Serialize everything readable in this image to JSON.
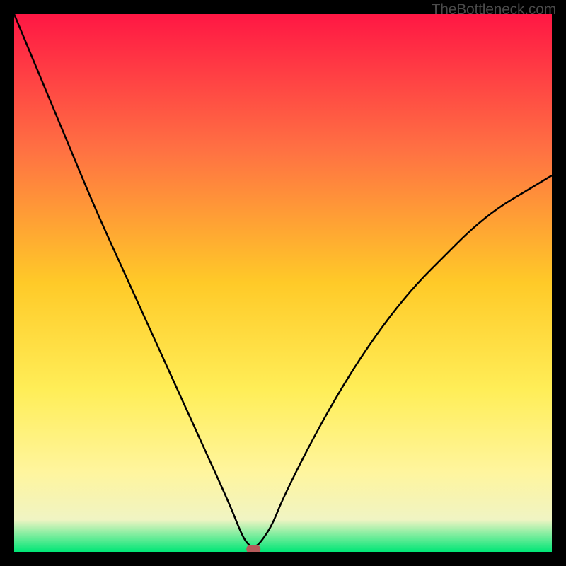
{
  "watermark": "TheBottleneck.com",
  "chart_data": {
    "type": "line",
    "title": "",
    "xlabel": "",
    "ylabel": "",
    "xlim": [
      0,
      100
    ],
    "ylim": [
      0,
      100
    ],
    "grid": false,
    "legend": false,
    "background_gradient": {
      "stops": [
        {
          "offset": 0,
          "color": "#ff1744"
        },
        {
          "offset": 25,
          "color": "#ff7043"
        },
        {
          "offset": 50,
          "color": "#ffca28"
        },
        {
          "offset": 70,
          "color": "#ffee58"
        },
        {
          "offset": 85,
          "color": "#fff59d"
        },
        {
          "offset": 94,
          "color": "#f0f4c3"
        },
        {
          "offset": 100,
          "color": "#00e676"
        }
      ]
    },
    "series": [
      {
        "name": "bottleneck-curve",
        "type": "line",
        "color": "#000000",
        "x": [
          0,
          5,
          10,
          15,
          20,
          25,
          30,
          35,
          40,
          42,
          43,
          44,
          45,
          46,
          48,
          50,
          55,
          60,
          65,
          70,
          75,
          80,
          85,
          90,
          95,
          100
        ],
        "y": [
          100,
          88,
          76,
          64,
          53,
          42,
          31,
          20,
          9,
          4,
          2,
          1,
          1,
          2,
          5,
          10,
          20,
          29,
          37,
          44,
          50,
          55,
          60,
          64,
          67,
          70
        ]
      }
    ],
    "marker": {
      "x": 44.5,
      "y": 0.5,
      "color": "#b55a5a",
      "shape": "rounded-rect"
    }
  }
}
